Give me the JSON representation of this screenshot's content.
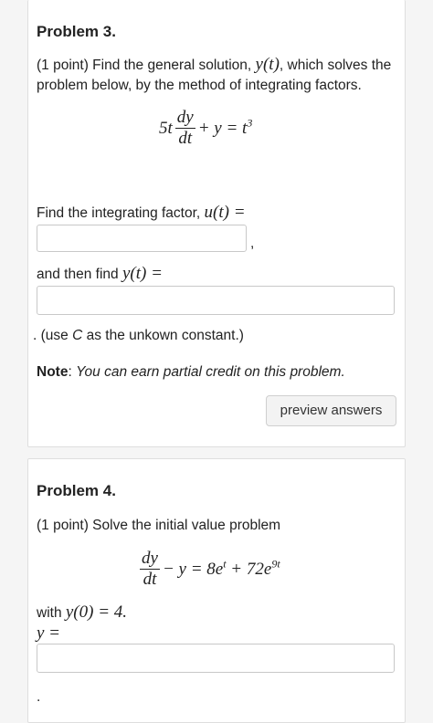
{
  "problem3": {
    "title": "Problem 3.",
    "prompt_line1_prefix": "(1 point) Find the general solution, ",
    "prompt_line1_math": "y(t)",
    "prompt_line1_suffix": ", which solves the",
    "prompt_line2": "problem below, by the method of integrating factors.",
    "equation": {
      "coef": "5t",
      "numerator": "dy",
      "denominator": "dt",
      "rhs_prefix": "+ y = t",
      "rhs_exponent": "3"
    },
    "integrating_factor_label": "Find the integrating factor, ",
    "integrating_factor_math": "u(t) =",
    "integrating_factor_input_value": "",
    "comma": ",",
    "then_find_label": "and then find ",
    "then_find_math": "y(t) =",
    "solution_input_value": "",
    "constant_note_prefix": ". (use ",
    "constant_note_var": "C",
    "constant_note_suffix": " as the unkown constant.)",
    "note_label": "Note",
    "note_colon": ": ",
    "note_text": "You can earn partial credit on this problem.",
    "preview_button_label": "preview answers"
  },
  "problem4": {
    "title": "Problem 4.",
    "prompt": "(1 point) Solve the initial value problem",
    "equation": {
      "numerator": "dy",
      "denominator": "dt",
      "middle": "− y = 8e",
      "exp1": "t",
      "plus": " + 72e",
      "exp2": "9t"
    },
    "condition_prefix": "with ",
    "condition_math": "y(0) = 4.",
    "answer_label": "y =",
    "answer_input_value": "",
    "trailing_period": "."
  }
}
